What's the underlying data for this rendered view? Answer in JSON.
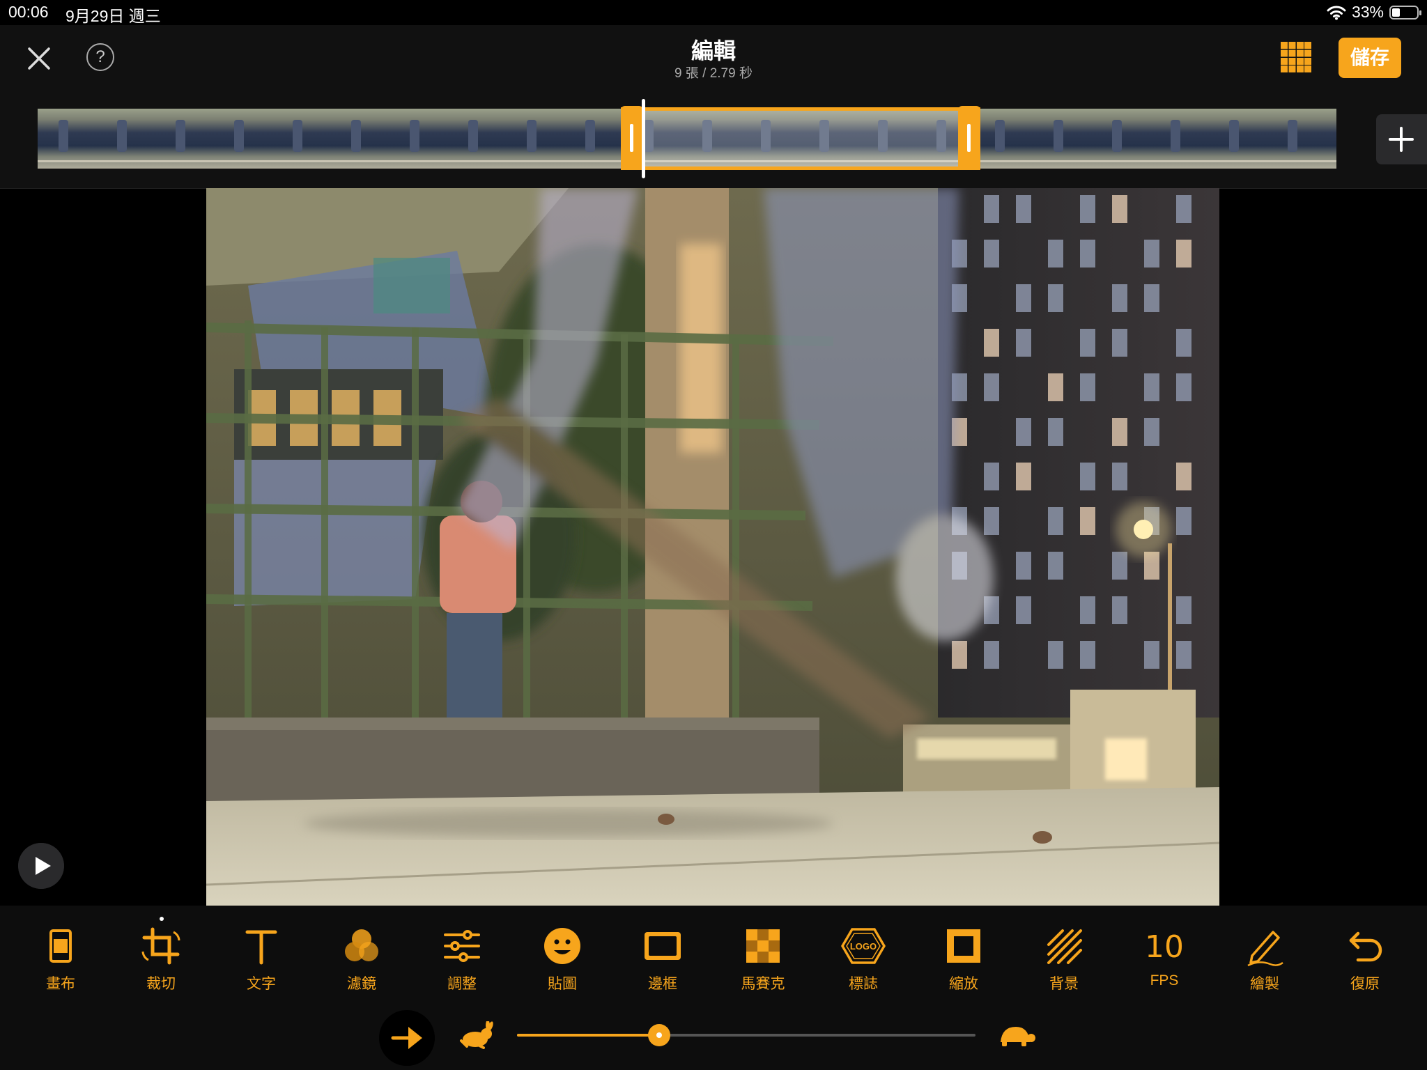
{
  "status_bar": {
    "time": "00:06",
    "date": "9月29日 週三",
    "battery": "33%",
    "battery_level": 0.33
  },
  "header": {
    "title": "編輯",
    "subtitle": "9 張 / 2.79 秒",
    "save_label": "儲存"
  },
  "tools": [
    {
      "label": "畫布",
      "icon": "canvas-icon"
    },
    {
      "label": "裁切",
      "icon": "crop-icon"
    },
    {
      "label": "文字",
      "icon": "text-icon"
    },
    {
      "label": "濾鏡",
      "icon": "filter-icon"
    },
    {
      "label": "調整",
      "icon": "adjust-icon"
    },
    {
      "label": "貼圖",
      "icon": "sticker-icon"
    },
    {
      "label": "邊框",
      "icon": "border-icon"
    },
    {
      "label": "馬賽克",
      "icon": "mosaic-icon"
    },
    {
      "label": "標誌",
      "icon": "logo-icon"
    },
    {
      "label": "縮放",
      "icon": "zoom-icon"
    },
    {
      "label": "背景",
      "icon": "background-icon"
    },
    {
      "label": "FPS",
      "icon": "fps-icon",
      "value": "10"
    },
    {
      "label": "繪製",
      "icon": "draw-icon"
    },
    {
      "label": "復原",
      "icon": "undo-icon"
    }
  ],
  "logo_badge_text": "LOGO",
  "speed": {
    "value": 0.31
  },
  "colors": {
    "accent": "#f7a51c",
    "background": "#000000",
    "toolbar": "#0d0d0d"
  }
}
